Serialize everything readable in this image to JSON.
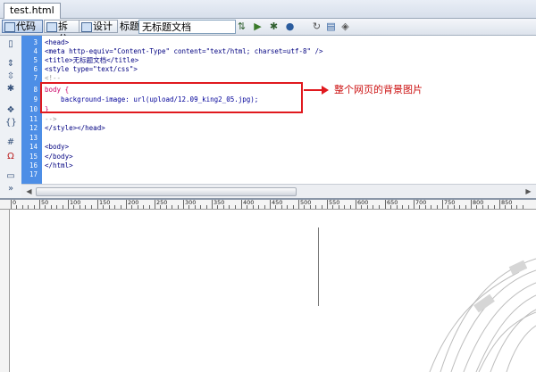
{
  "tab": {
    "title": "test.html"
  },
  "toolbar": {
    "code_label": "代码",
    "split_label": "拆分",
    "design_label": "设计",
    "title_label": "标题:",
    "title_value": "无标题文档"
  },
  "code": {
    "line_numbers": [
      "3",
      "4",
      "5",
      "6",
      "7",
      "8",
      "9",
      "10",
      "11",
      "12",
      "13",
      "14",
      "15",
      "16",
      "17"
    ],
    "lines": [
      "<head>",
      "<meta http-equiv=\"Content-Type\" content=\"text/html; charset=utf-8\" />",
      "<title>无标题文档</title>",
      "<style type=\"text/css\">",
      "<!--",
      "body {",
      "    background-image: url(upload/12.09_king2_05.jpg);",
      "}",
      "-->",
      "</style></head>",
      "",
      "<body>",
      "</body>",
      "</html>",
      ""
    ]
  },
  "annotation": {
    "text": "整个网页的背景图片"
  },
  "ruler": {
    "labels": [
      "0",
      "50",
      "100",
      "150",
      "200",
      "250",
      "300",
      "350",
      "400",
      "450",
      "500",
      "550",
      "600",
      "650",
      "700",
      "750",
      "800",
      "850"
    ]
  },
  "colors": {
    "gutter": "#4d8ee6",
    "highlight": "#e0191e"
  }
}
